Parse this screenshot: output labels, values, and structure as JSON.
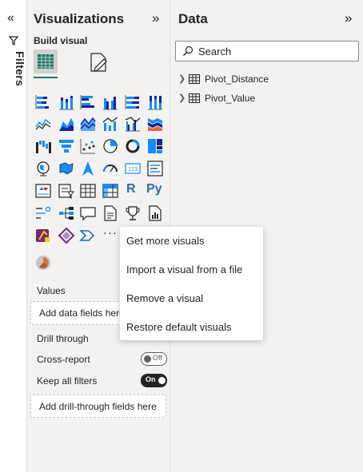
{
  "filters": {
    "label": "Filters"
  },
  "visualizations": {
    "title": "Visualizations",
    "build_visual_label": "Build visual",
    "more_label": "···",
    "values_label": "Values",
    "values_well": "Add data fields here",
    "drill_through_label": "Drill through",
    "cross_report_label": "Cross-report",
    "cross_report_state": "Off",
    "keep_filters_label": "Keep all filters",
    "keep_filters_state": "On",
    "drill_well": "Add drill-through fields here",
    "r_visual": "R",
    "py_visual": "Py",
    "accent": "#117865"
  },
  "data_pane": {
    "title": "Data",
    "search_placeholder": "Search",
    "tables": [
      {
        "label": "Pivot_Distance"
      },
      {
        "label": "Pivot_Value"
      }
    ]
  },
  "context_menu": {
    "items": [
      {
        "label": "Get more visuals"
      },
      {
        "label": "Import a visual from a file"
      },
      {
        "label": "Remove a visual"
      },
      {
        "label": "Restore default visuals"
      }
    ]
  }
}
